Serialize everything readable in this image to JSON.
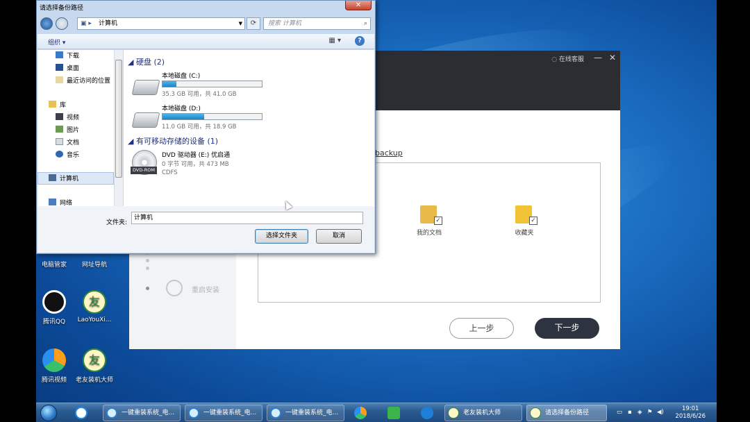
{
  "dialog": {
    "title": "请选择备份路径",
    "close": "✕",
    "address": "计算机",
    "search_placeholder": "搜索 计算机",
    "organize": "组织 ▾",
    "nav": [
      "下载",
      "桌面",
      "最近访问的位置",
      "库",
      "视频",
      "图片",
      "文档",
      "音乐",
      "计算机",
      "网络"
    ],
    "groups": {
      "hard_disks": "硬盘 (2)",
      "removable": "有可移动存储的设备 (1)"
    },
    "drives": [
      {
        "name": "本地磁盘 (C:)",
        "info": "35.3 GB 可用，共 41.0 GB",
        "used_fraction": 0.14
      },
      {
        "name": "本地磁盘 (D:)",
        "info": "11.0 GB 可用，共 18.9 GB",
        "used_fraction": 0.42
      }
    ],
    "dvd": {
      "name": "DVD 驱动器 (E:) 优启通",
      "info": "0 字节 可用，共 473 MB",
      "fs": "CDFS",
      "badge": "DVD-ROM"
    },
    "filename_label": "文件夹:",
    "filename_value": "计算机",
    "select_button": "选择文件夹",
    "cancel_button": "取消"
  },
  "app": {
    "online_service": "在线客服",
    "minimize": "—",
    "close": "✕",
    "path_fragment": "backup",
    "step_restart": "重启安装",
    "folders": [
      "我的文档",
      "收藏夹"
    ],
    "prev_button": "上一步",
    "next_button": "下一步"
  },
  "desktop_icons": [
    "电脑管家",
    "网址导航",
    "腾讯QQ",
    "LaoYouXi...",
    "腾讯视频",
    "老友装机大师"
  ],
  "taskbar": {
    "tasks": [
      "一键重装系统_电...",
      "一键重装系统_电...",
      "一键重装系统_电...",
      "老友装机大师",
      "请选择备份路径"
    ],
    "time": "19:01",
    "date": "2018/6/26"
  }
}
